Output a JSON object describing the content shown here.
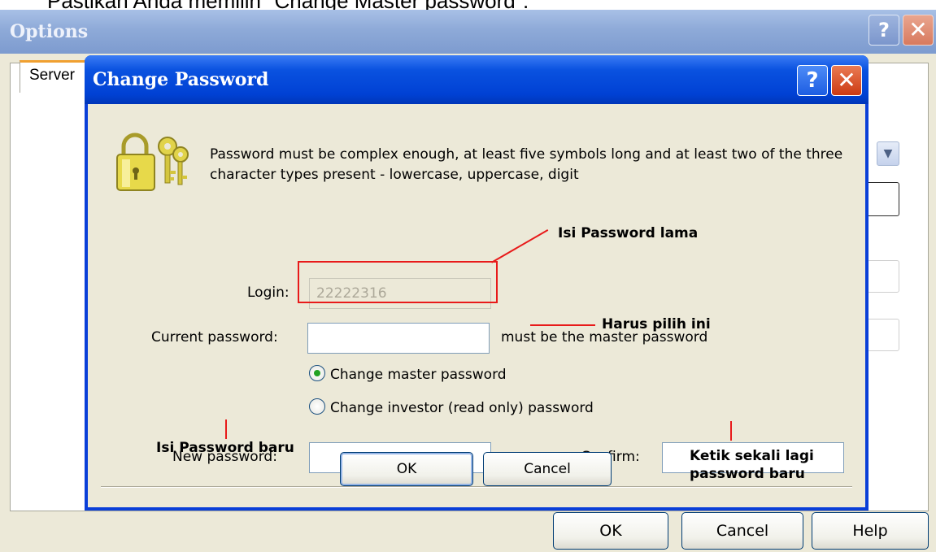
{
  "caption": "Pastikan Anda memilih \"Change Master password\".",
  "options_window": {
    "title": "Options",
    "help_glyph": "?",
    "close_glyph": "✕",
    "tab_label": "Server",
    "buttons": {
      "ok": "OK",
      "cancel": "Cancel",
      "help": "Help"
    }
  },
  "dialog": {
    "title": "Change Password",
    "help_glyph": "?",
    "close_glyph": "✕",
    "info_text": "Password must be complex enough, at least five symbols long and at least two of the three character types present - lowercase, uppercase, digit",
    "login_label": "Login:",
    "login_value": "22222316",
    "current_password_label": "Current password:",
    "current_password_value": "",
    "current_password_hint": "must be the master password",
    "radio_master": "Change master password",
    "radio_investor": "Change investor (read only) password",
    "new_password_label": "New password:",
    "new_password_value": "",
    "confirm_label": "Confirm:",
    "confirm_value": "",
    "ok_label": "OK",
    "cancel_label": "Cancel"
  },
  "annotations": {
    "old_password": "Isi Password lama",
    "must_choose": "Harus pilih ini",
    "new_password": "Isi Password baru",
    "retype_line1": "Ketik sekali lagi",
    "retype_line2": "password baru"
  },
  "colors": {
    "annotation_red": "#e81a1a",
    "dialog_titlebar": "#0041d4",
    "options_titlebar": "#8eaad8",
    "dialog_body": "#ece9d8"
  },
  "icons": [
    "lock-keys-icon",
    "help-icon",
    "close-icon",
    "dropdown-arrow-icon",
    "radio-icon"
  ]
}
